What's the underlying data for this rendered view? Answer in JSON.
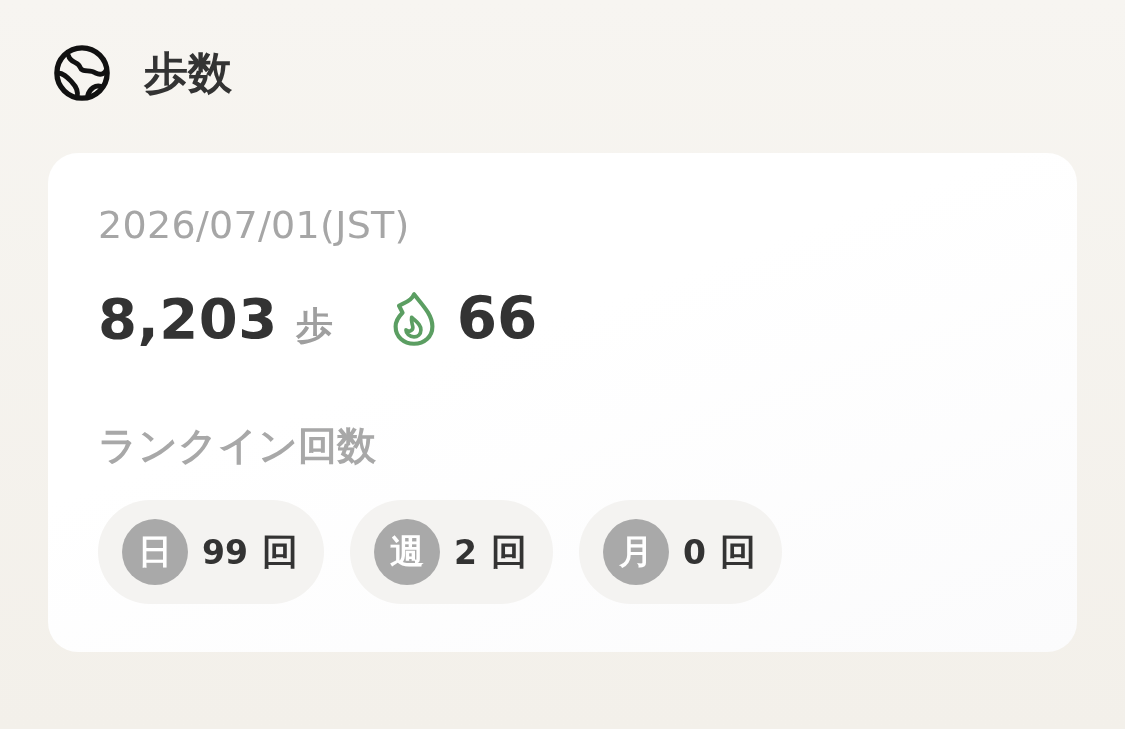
{
  "header": {
    "title": "歩数"
  },
  "card": {
    "date": "2026/07/01(JST)",
    "steps": {
      "value": "8,203",
      "unit": "歩"
    },
    "streak": {
      "value": "66"
    },
    "rank_in": {
      "label": "ランクイン回数",
      "counts": [
        {
          "period": "日",
          "count": "99",
          "unit": "回"
        },
        {
          "period": "週",
          "count": "2",
          "unit": "回"
        },
        {
          "period": "月",
          "count": "0",
          "unit": "回"
        }
      ]
    }
  }
}
